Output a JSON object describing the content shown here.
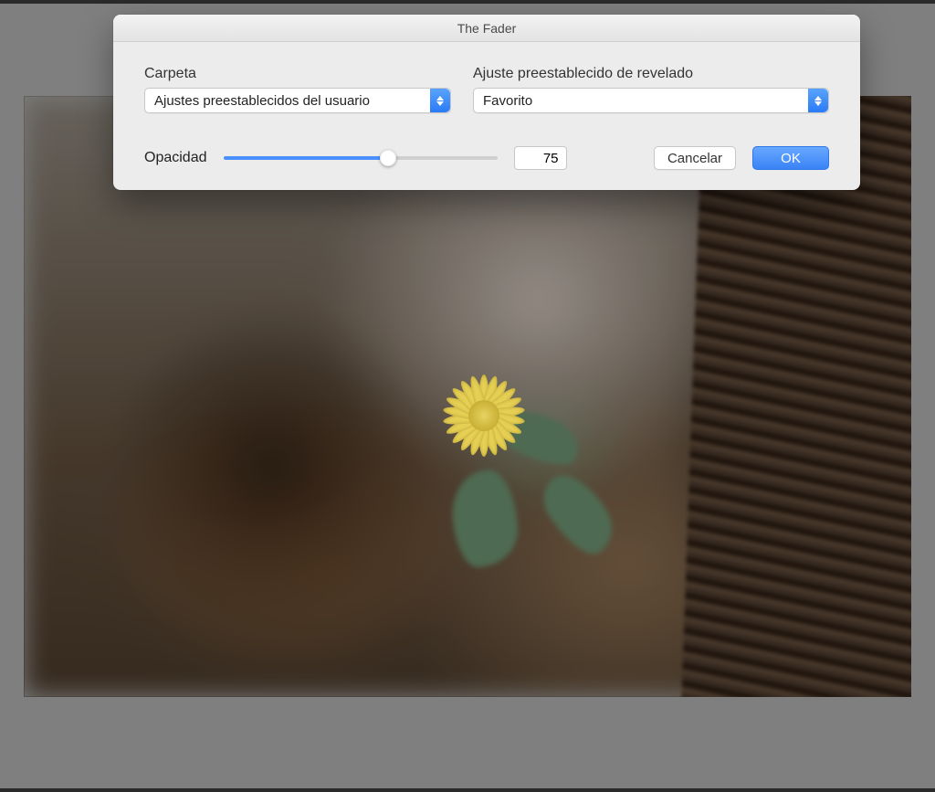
{
  "dialog": {
    "title": "The Fader",
    "folder": {
      "label": "Carpeta",
      "selected": "Ajustes preestablecidos del usuario"
    },
    "preset": {
      "label": "Ajuste preestablecido de revelado",
      "selected": "Favorito"
    },
    "opacity": {
      "label": "Opacidad",
      "value": "75",
      "percent": 60
    },
    "buttons": {
      "cancel": "Cancelar",
      "ok": "OK"
    }
  },
  "colors": {
    "accent": "#3a83f6",
    "dialog_bg": "#ececec",
    "app_bg": "#7f7f7f"
  }
}
